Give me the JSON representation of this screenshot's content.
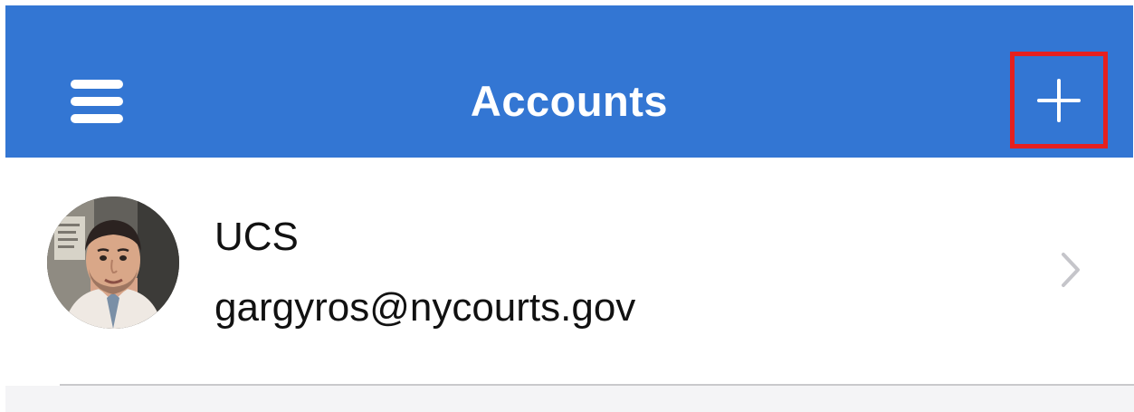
{
  "header": {
    "title": "Accounts",
    "menu_icon": "hamburger-menu-icon",
    "add_icon": "plus-icon",
    "background_color": "#3376d3",
    "highlight_color": "#e5201f"
  },
  "accounts": [
    {
      "name": "UCS",
      "email": "gargyros@nycourts.gov",
      "avatar_icon": "profile-photo",
      "chevron_icon": "chevron-right-icon"
    }
  ]
}
